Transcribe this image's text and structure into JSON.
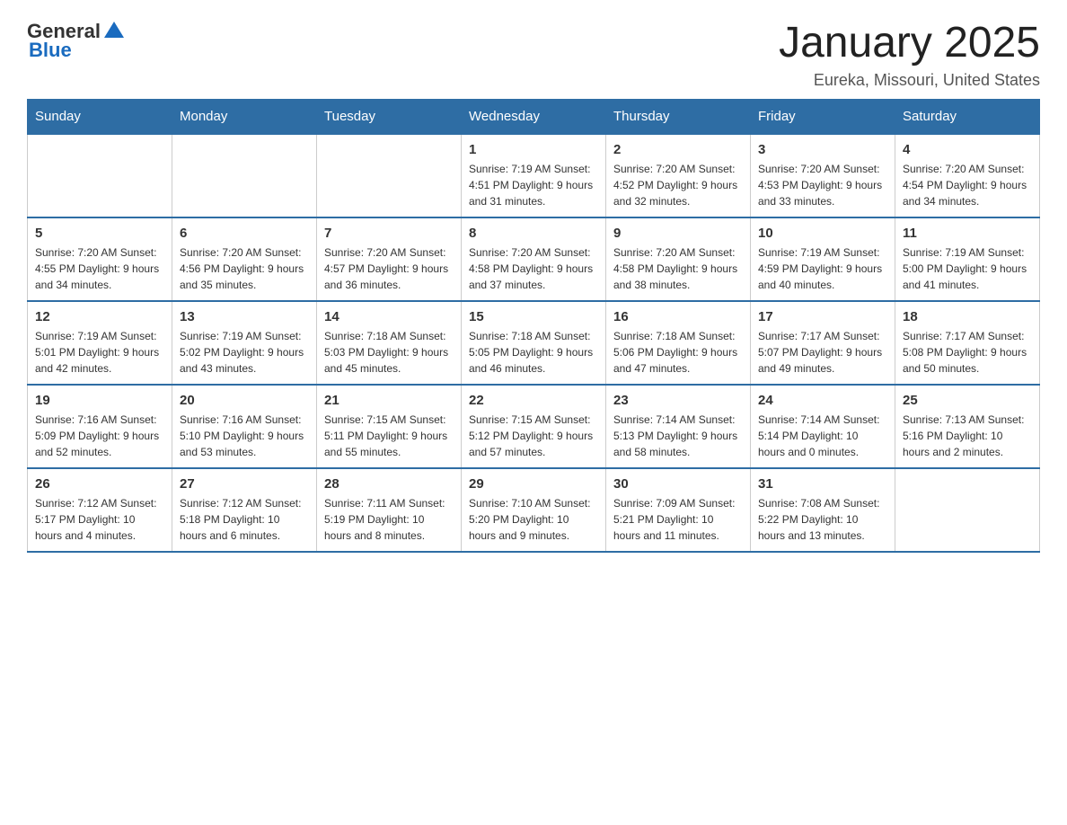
{
  "logo": {
    "text_general": "General",
    "text_blue": "Blue"
  },
  "header": {
    "month_year": "January 2025",
    "location": "Eureka, Missouri, United States"
  },
  "days_of_week": [
    "Sunday",
    "Monday",
    "Tuesday",
    "Wednesday",
    "Thursday",
    "Friday",
    "Saturday"
  ],
  "weeks": [
    [
      {
        "day": "",
        "info": ""
      },
      {
        "day": "",
        "info": ""
      },
      {
        "day": "",
        "info": ""
      },
      {
        "day": "1",
        "info": "Sunrise: 7:19 AM\nSunset: 4:51 PM\nDaylight: 9 hours and 31 minutes."
      },
      {
        "day": "2",
        "info": "Sunrise: 7:20 AM\nSunset: 4:52 PM\nDaylight: 9 hours and 32 minutes."
      },
      {
        "day": "3",
        "info": "Sunrise: 7:20 AM\nSunset: 4:53 PM\nDaylight: 9 hours and 33 minutes."
      },
      {
        "day": "4",
        "info": "Sunrise: 7:20 AM\nSunset: 4:54 PM\nDaylight: 9 hours and 34 minutes."
      }
    ],
    [
      {
        "day": "5",
        "info": "Sunrise: 7:20 AM\nSunset: 4:55 PM\nDaylight: 9 hours and 34 minutes."
      },
      {
        "day": "6",
        "info": "Sunrise: 7:20 AM\nSunset: 4:56 PM\nDaylight: 9 hours and 35 minutes."
      },
      {
        "day": "7",
        "info": "Sunrise: 7:20 AM\nSunset: 4:57 PM\nDaylight: 9 hours and 36 minutes."
      },
      {
        "day": "8",
        "info": "Sunrise: 7:20 AM\nSunset: 4:58 PM\nDaylight: 9 hours and 37 minutes."
      },
      {
        "day": "9",
        "info": "Sunrise: 7:20 AM\nSunset: 4:58 PM\nDaylight: 9 hours and 38 minutes."
      },
      {
        "day": "10",
        "info": "Sunrise: 7:19 AM\nSunset: 4:59 PM\nDaylight: 9 hours and 40 minutes."
      },
      {
        "day": "11",
        "info": "Sunrise: 7:19 AM\nSunset: 5:00 PM\nDaylight: 9 hours and 41 minutes."
      }
    ],
    [
      {
        "day": "12",
        "info": "Sunrise: 7:19 AM\nSunset: 5:01 PM\nDaylight: 9 hours and 42 minutes."
      },
      {
        "day": "13",
        "info": "Sunrise: 7:19 AM\nSunset: 5:02 PM\nDaylight: 9 hours and 43 minutes."
      },
      {
        "day": "14",
        "info": "Sunrise: 7:18 AM\nSunset: 5:03 PM\nDaylight: 9 hours and 45 minutes."
      },
      {
        "day": "15",
        "info": "Sunrise: 7:18 AM\nSunset: 5:05 PM\nDaylight: 9 hours and 46 minutes."
      },
      {
        "day": "16",
        "info": "Sunrise: 7:18 AM\nSunset: 5:06 PM\nDaylight: 9 hours and 47 minutes."
      },
      {
        "day": "17",
        "info": "Sunrise: 7:17 AM\nSunset: 5:07 PM\nDaylight: 9 hours and 49 minutes."
      },
      {
        "day": "18",
        "info": "Sunrise: 7:17 AM\nSunset: 5:08 PM\nDaylight: 9 hours and 50 minutes."
      }
    ],
    [
      {
        "day": "19",
        "info": "Sunrise: 7:16 AM\nSunset: 5:09 PM\nDaylight: 9 hours and 52 minutes."
      },
      {
        "day": "20",
        "info": "Sunrise: 7:16 AM\nSunset: 5:10 PM\nDaylight: 9 hours and 53 minutes."
      },
      {
        "day": "21",
        "info": "Sunrise: 7:15 AM\nSunset: 5:11 PM\nDaylight: 9 hours and 55 minutes."
      },
      {
        "day": "22",
        "info": "Sunrise: 7:15 AM\nSunset: 5:12 PM\nDaylight: 9 hours and 57 minutes."
      },
      {
        "day": "23",
        "info": "Sunrise: 7:14 AM\nSunset: 5:13 PM\nDaylight: 9 hours and 58 minutes."
      },
      {
        "day": "24",
        "info": "Sunrise: 7:14 AM\nSunset: 5:14 PM\nDaylight: 10 hours and 0 minutes."
      },
      {
        "day": "25",
        "info": "Sunrise: 7:13 AM\nSunset: 5:16 PM\nDaylight: 10 hours and 2 minutes."
      }
    ],
    [
      {
        "day": "26",
        "info": "Sunrise: 7:12 AM\nSunset: 5:17 PM\nDaylight: 10 hours and 4 minutes."
      },
      {
        "day": "27",
        "info": "Sunrise: 7:12 AM\nSunset: 5:18 PM\nDaylight: 10 hours and 6 minutes."
      },
      {
        "day": "28",
        "info": "Sunrise: 7:11 AM\nSunset: 5:19 PM\nDaylight: 10 hours and 8 minutes."
      },
      {
        "day": "29",
        "info": "Sunrise: 7:10 AM\nSunset: 5:20 PM\nDaylight: 10 hours and 9 minutes."
      },
      {
        "day": "30",
        "info": "Sunrise: 7:09 AM\nSunset: 5:21 PM\nDaylight: 10 hours and 11 minutes."
      },
      {
        "day": "31",
        "info": "Sunrise: 7:08 AM\nSunset: 5:22 PM\nDaylight: 10 hours and 13 minutes."
      },
      {
        "day": "",
        "info": ""
      }
    ]
  ]
}
